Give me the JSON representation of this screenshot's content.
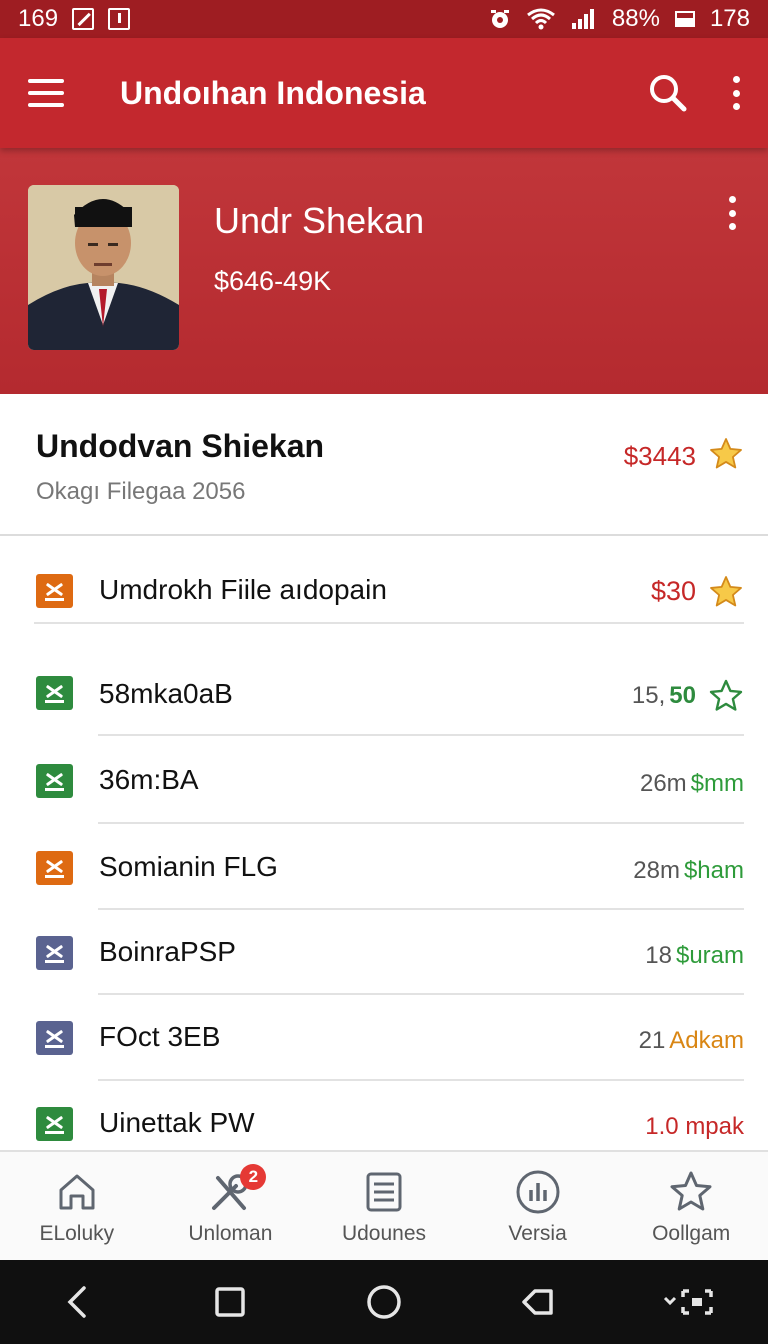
{
  "status_bar": {
    "left_number": "169",
    "battery": "88%",
    "right_number": "178"
  },
  "app_bar": {
    "title": "Undoıhan Indonesia"
  },
  "profile": {
    "name": "Undr Shekan",
    "amount": "$646-49K"
  },
  "summary": {
    "name": "Undodvan Shiekan",
    "subtitle": "Okagı Filegaa 2056",
    "price": "$3443"
  },
  "list": [
    {
      "label": "Umdrokh Fiile aıdopain",
      "qty": "",
      "value": "$30",
      "value_color": "#c62828",
      "icon_color": "#de6a12",
      "star": "filled"
    },
    {
      "label": "58mka0aB",
      "qty": "15,",
      "value": "50",
      "value_color": "#2e8b3e",
      "icon_color": "#2e8b3e",
      "star": "outline"
    },
    {
      "label": "36m:BA",
      "qty": "26m",
      "value": "$mm",
      "value_color": "#2e9b3a",
      "icon_color": "#2e8b3e",
      "star": ""
    },
    {
      "label": "Somianin FLG",
      "qty": "28m",
      "value": "$ham",
      "value_color": "#2e9b3a",
      "icon_color": "#de6a12",
      "star": ""
    },
    {
      "label": "BoinraPSP",
      "qty": "18",
      "value": "$uram",
      "value_color": "#2e9b3a",
      "icon_color": "#5a6390",
      "star": ""
    },
    {
      "label": "FOct 3EB",
      "qty": "21",
      "value": "Adkam",
      "value_color": "#d98614",
      "icon_color": "#5a6390",
      "star": ""
    },
    {
      "label": "Uinettak PW",
      "qty": "",
      "value": "1.0 mpak",
      "value_color": "#c62828",
      "icon_color": "#2e8b3e",
      "star": ""
    }
  ],
  "bottom_nav": [
    {
      "label": "ELoluky",
      "icon": "home-icon"
    },
    {
      "label": "Unloman",
      "icon": "tools-icon",
      "badge": "2"
    },
    {
      "label": "Udounes",
      "icon": "list-icon"
    },
    {
      "label": "Versia",
      "icon": "chart-icon"
    },
    {
      "label": "Oollgam",
      "icon": "star-icon"
    }
  ],
  "colors": {
    "primary": "#c3282e",
    "status_bar": "#9e1d22",
    "accent_red": "#c62828",
    "star_fill": "#f7c948"
  }
}
